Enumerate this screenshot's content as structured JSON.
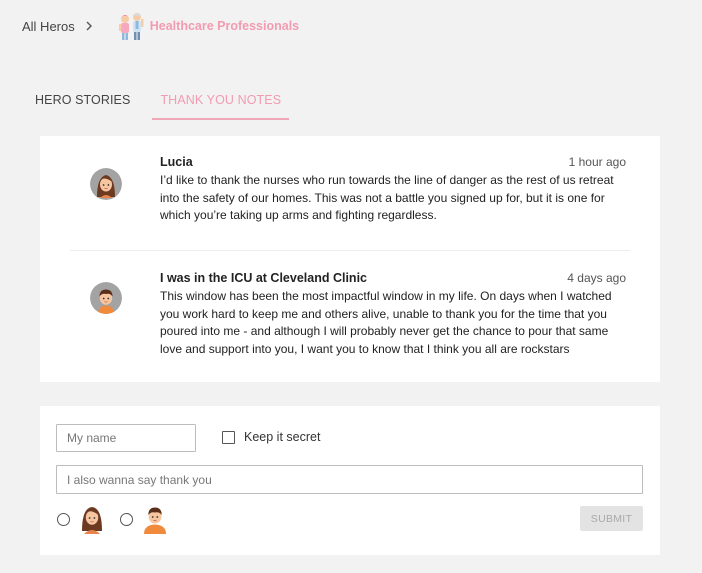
{
  "breadcrumb": {
    "root": "All Heros",
    "current": "Healthcare Professionals"
  },
  "tabs": [
    {
      "label": "HERO STORIES",
      "active": false
    },
    {
      "label": "THANK YOU NOTES",
      "active": true
    }
  ],
  "notes": [
    {
      "author": "Lucia",
      "time": "1 hour ago",
      "text": "I’d like to thank the nurses who run towards the line of danger as the rest of us retreat into the safety of our homes. This was not a battle you signed up for, but it is one for which you’re taking up arms and fighting regardless.",
      "avatar": "girl-avatar-icon"
    },
    {
      "author": "I was in the ICU at Cleveland Clinic",
      "time": "4 days ago",
      "text": "This window has been the most impactful window in my life. On days when I watched you work hard to keep me and others alive, unable to thank you for the time that you poured into me - and although I will probably never get the chance to pour that same love and support into you, I want you to know that I think you all are rockstars",
      "avatar": "boy-avatar-icon"
    }
  ],
  "form": {
    "name_placeholder": "My name",
    "secret_label": "Keep it secret",
    "message_placeholder": "I also wanna say thank you",
    "submit_label": "SUBMIT"
  },
  "colors": {
    "accent": "#f29bb1",
    "background": "#f2f2f2",
    "card": "#ffffff"
  }
}
